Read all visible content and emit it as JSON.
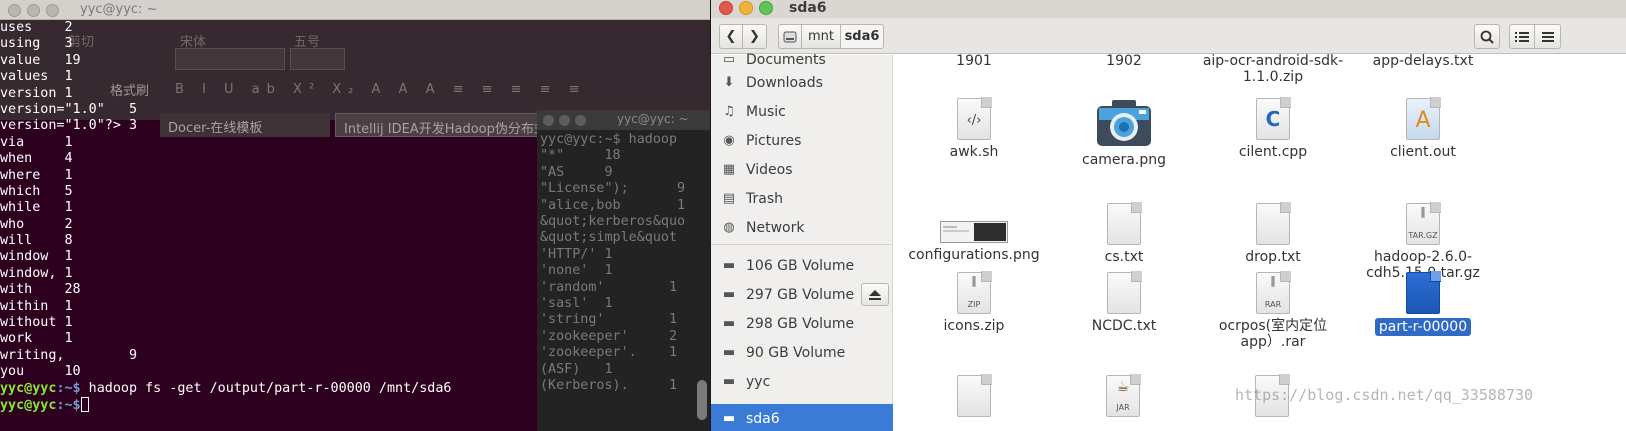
{
  "terminal": {
    "title": "yyc@yyc: ~",
    "lines": [
      "uses    2",
      "using   3",
      "value   19",
      "values  1",
      "version 1",
      "version=\"1.0\"   5",
      "version=\"1.0\"?> 3",
      "via     1",
      "when    4",
      "where   1",
      "which   5",
      "while   1",
      "who     2",
      "will    8",
      "window  1",
      "window, 1",
      "with    28",
      "within  1",
      "without 1",
      "work    1",
      "writing,        9",
      "you     10"
    ],
    "prompt_user": "yyc@yyc",
    "prompt_path": ":~$",
    "command": " hadoop fs -get /output/part-r-00000 /mnt/sda6",
    "prompt2_user": "yyc@yyc",
    "prompt2_path": ":~$"
  },
  "background_office": {
    "font_name": "宋体",
    "font_size": "五号",
    "format_painter": "格式刷",
    "cut": "剪切",
    "tab1": "Docer-在线模板",
    "tab2": "Intellij IDEA开发Hadoop伪分布式应用.docx *"
  },
  "background_terminal": {
    "title": "yyc@yyc: ~",
    "lines": [
      "yyc@yyc:~$ hadoop",
      "\"*\"     18",
      "\"AS     9",
      "\"License\");      9",
      "\"alice,bob       1",
      "&quot;kerberos&quo",
      "&quot;simple&quot",
      "'HTTP/' 1",
      "'none'  1",
      "'random'        1",
      "'sasl'  1",
      "'string'        1",
      "'zookeeper'     2",
      "'zookeeper'.    1",
      "(ASF)   1",
      "(Kerberos).     1"
    ]
  },
  "file_manager": {
    "title": "sda6",
    "breadcrumb": [
      "mnt",
      "sda6"
    ],
    "sidebar": [
      {
        "label": "Documents",
        "icon": "folder-icon"
      },
      {
        "label": "Downloads",
        "icon": "download-icon"
      },
      {
        "label": "Music",
        "icon": "music-icon"
      },
      {
        "label": "Pictures",
        "icon": "camera-icon"
      },
      {
        "label": "Videos",
        "icon": "film-icon"
      },
      {
        "label": "Trash",
        "icon": "trash-icon"
      },
      {
        "label": "Network",
        "icon": "network-icon"
      },
      {
        "label": "106 GB Volume",
        "icon": "drive-icon"
      },
      {
        "label": "297 GB Volume",
        "icon": "drive-icon"
      },
      {
        "label": "298 GB Volume",
        "icon": "drive-icon"
      },
      {
        "label": "90 GB Volume",
        "icon": "drive-icon"
      },
      {
        "label": "yyc",
        "icon": "drive-icon"
      },
      {
        "label": "sda6",
        "icon": "drive-icon"
      }
    ],
    "files": [
      {
        "name": "1901",
        "icon": "none"
      },
      {
        "name": "1902",
        "icon": "none"
      },
      {
        "name": "aip-ocr-android-sdk-1.1.0.zip",
        "icon": "none"
      },
      {
        "name": "app-delays.txt",
        "icon": "none"
      },
      {
        "name": "awk.sh",
        "icon": "script-icon"
      },
      {
        "name": "camera.png",
        "icon": "camera-image-icon"
      },
      {
        "name": "cilent.cpp",
        "icon": "cpp-icon"
      },
      {
        "name": "client.out",
        "icon": "executable-icon"
      },
      {
        "name": "configurations.png",
        "icon": "image-thumbnail-icon"
      },
      {
        "name": "cs.txt",
        "icon": "text-file-icon"
      },
      {
        "name": "drop.txt",
        "icon": "text-file-icon"
      },
      {
        "name": "hadoop-2.6.0-cdh5.15.0.tar.gz",
        "icon": "tar-icon"
      },
      {
        "name": "icons.zip",
        "icon": "zip-icon"
      },
      {
        "name": "NCDC.txt",
        "icon": "text-file-icon"
      },
      {
        "name": "ocrpos(室内定位app）.rar",
        "icon": "rar-icon"
      },
      {
        "name": "part-r-00000",
        "icon": "blue-file-icon"
      }
    ],
    "selected_file": "part-r-00000",
    "icon_labels": {
      "zip": "ZIP",
      "rar": "RAR",
      "tar": "TAR.GZ",
      "jar": "JAR"
    }
  },
  "watermark": "https://blog.csdn.net/qq_33588730"
}
